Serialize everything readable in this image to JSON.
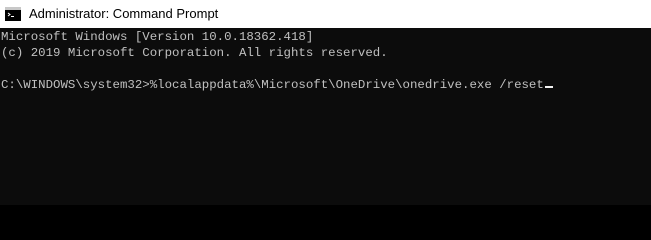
{
  "window": {
    "title": "Administrator: Command Prompt",
    "icon": "cmd-icon"
  },
  "console": {
    "lines": [
      "Microsoft Windows [Version 10.0.18362.418]",
      "(c) 2019 Microsoft Corporation. All rights reserved.",
      ""
    ],
    "prompt": "C:\\WINDOWS\\system32>",
    "command": "%localappdata%\\Microsoft\\OneDrive\\onedrive.exe /reset"
  },
  "colors": {
    "background": "#0c0c0c",
    "text": "#c0c0c0",
    "titlebar": "#ffffff"
  }
}
